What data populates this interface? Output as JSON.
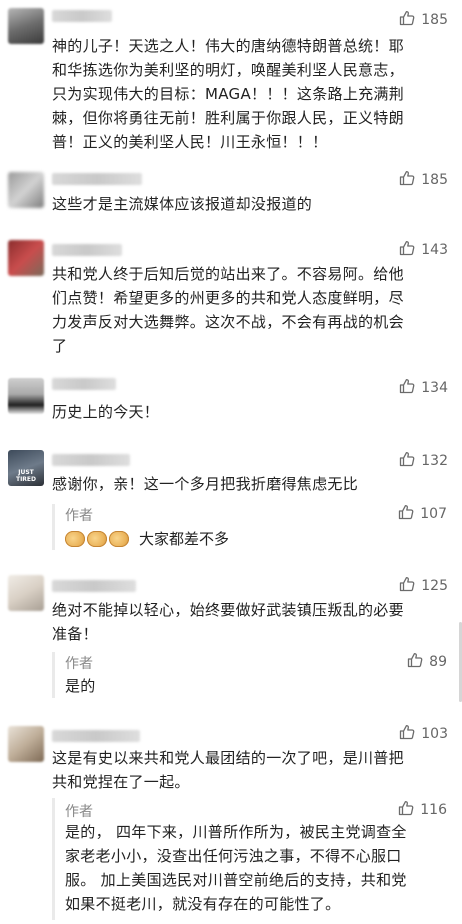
{
  "comments": [
    {
      "likes": "185",
      "text": "神的儿子！天选之人！伟大的唐纳德特朗普总统！耶\n和华拣选你为美利坚的明灯，唤醒美利坚人民意志，\n只为实现伟大的目标：MAGA！！！这条路上充满荆\n棘，但你将勇往无前！胜利属于你跟人民，正义特朗\n普！正义的美利坚人民！川王永恒！！！"
    },
    {
      "likes": "185",
      "text": "这些才是主流媒体应该报道却没报道的"
    },
    {
      "likes": "143",
      "text": "共和党人终于后知后觉的站出来了。不容易阿。给他\n们点赞！希望更多的州更多的共和党人态度鲜明，尽\n力发声反对大选舞弊。这次不战，不会有再战的机会\n了"
    },
    {
      "likes": "134",
      "text": "历史上的今天！"
    },
    {
      "likes": "132",
      "avatar_caption": "JUST TIRED",
      "text": "感谢你，亲！这一个多月把我折磨得焦虑无比",
      "reply": {
        "author": "作者",
        "likes": "107",
        "text": "大家都差不多"
      }
    },
    {
      "likes": "125",
      "text": "绝对不能掉以轻心，始终要做好武装镇压叛乱的必要\n准备！",
      "reply": {
        "author": "作者",
        "likes": "89",
        "text": "是的"
      }
    },
    {
      "likes": "103",
      "text": "这是有史以来共和党人最团结的一次了吧，是川普把\n共和党捏在了一起。",
      "reply": {
        "author": "作者",
        "likes": "116",
        "text": "是的，  四年下来，川普所作所为，被民主党调查全\n家老老小小，没查出任何污浊之事，不得不心服口\n服。 加上美国选民对川普空前绝后的支持，共和党\n如果不挺老川，就没有存在的可能性了。"
      }
    }
  ],
  "colors": {
    "text": "#222222",
    "muted": "#888888",
    "like": "#666666",
    "reply_border": "#eaeaea"
  },
  "icons": {
    "like": "thumbs-up-icon",
    "emoji": "handshake-emoji"
  }
}
